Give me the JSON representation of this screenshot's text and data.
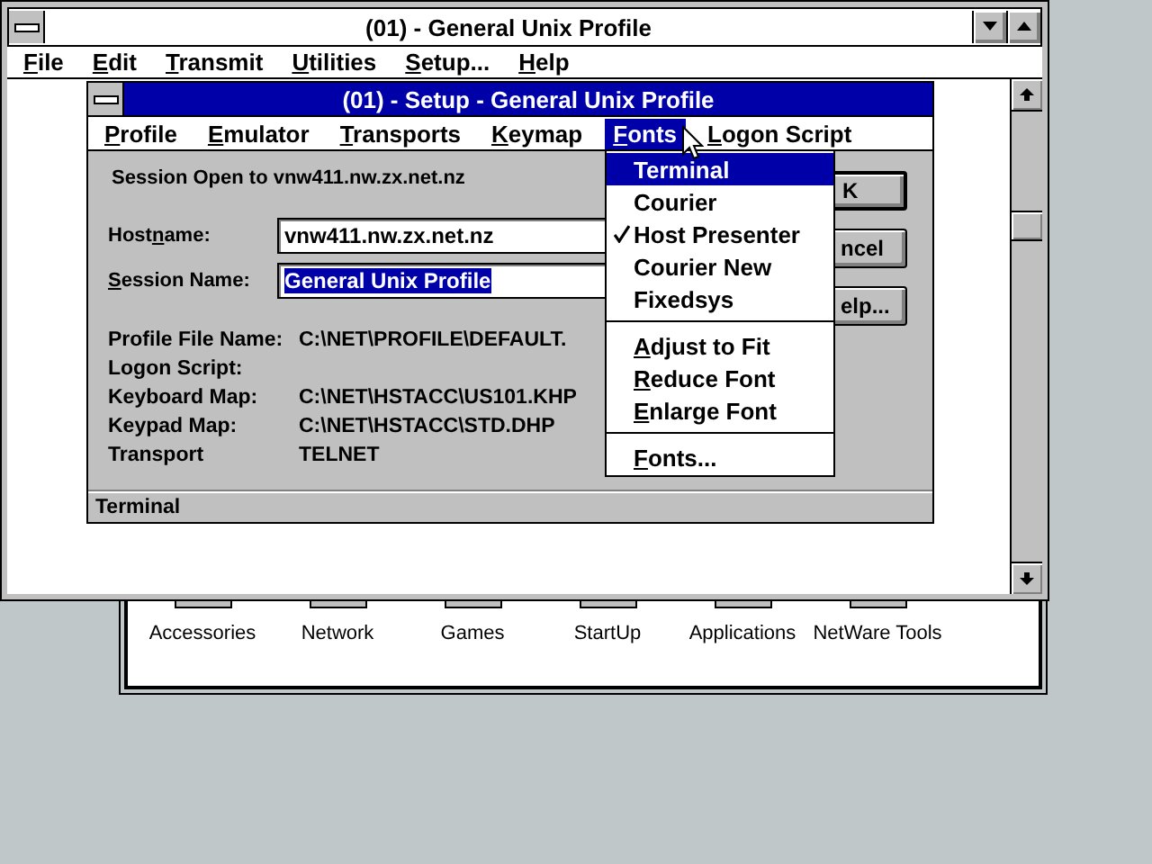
{
  "program_group_window": {
    "groups": [
      {
        "label": "Accessories"
      },
      {
        "label": "Network"
      },
      {
        "label": "Games"
      },
      {
        "label": "StartUp"
      },
      {
        "label": "Applications"
      },
      {
        "label": "NetWare Tools"
      }
    ]
  },
  "main_window": {
    "title": "(01) - General Unix Profile",
    "menu": [
      {
        "label": "File"
      },
      {
        "label": "Edit"
      },
      {
        "label": "Transmit"
      },
      {
        "label": "Utilities"
      },
      {
        "label": "Setup..."
      },
      {
        "label": "Help"
      }
    ]
  },
  "setup_dialog": {
    "title": "(01) - Setup - General Unix Profile",
    "menu": [
      {
        "label": "Profile",
        "selected": false
      },
      {
        "label": "Emulator",
        "selected": false
      },
      {
        "label": "Transports",
        "selected": false
      },
      {
        "label": "Keymap",
        "selected": false
      },
      {
        "label": "Fonts",
        "selected": true
      },
      {
        "label": "Logon Script",
        "selected": false
      }
    ],
    "session_status": "Session Open to vnw411.nw.zx.net.nz",
    "hostname": {
      "label_parts": [
        "Host",
        "n",
        "ame:"
      ],
      "value": "vnw411.nw.zx.net.nz"
    },
    "session_name": {
      "label": "Session Name:",
      "value": "General Unix Profile",
      "selected": true
    },
    "info": [
      {
        "label": "Profile File Name:",
        "value": "C:\\NET\\PROFILE\\DEFAULT."
      },
      {
        "label": "Logon Script:"
      },
      {
        "label": "Keyboard Map:",
        "value": "C:\\NET\\HSTACC\\US101.KHP"
      },
      {
        "label": "Keypad Map:",
        "value": "C:\\NET\\HSTACC\\STD.DHP"
      },
      {
        "label": "Transport",
        "value": "TELNET"
      }
    ],
    "buttons": [
      {
        "label": "K",
        "default": true
      },
      {
        "label": "ncel",
        "default": false
      },
      {
        "label": "elp...",
        "default": false
      }
    ],
    "status_bar": "Terminal"
  },
  "fonts_menu": [
    {
      "kind": "item",
      "label": "Terminal",
      "selected": true,
      "checked": false,
      "mnemonic": false
    },
    {
      "kind": "item",
      "label": "Courier",
      "selected": false,
      "checked": false,
      "mnemonic": false
    },
    {
      "kind": "item",
      "label": "Host Presenter",
      "selected": false,
      "checked": true,
      "mnemonic": false
    },
    {
      "kind": "item",
      "label": "Courier New",
      "selected": false,
      "checked": false,
      "mnemonic": false
    },
    {
      "kind": "item",
      "label": "Fixedsys",
      "selected": false,
      "checked": false,
      "mnemonic": false
    },
    {
      "kind": "separator"
    },
    {
      "kind": "item",
      "label": "Adjust to Fit",
      "selected": false,
      "checked": false,
      "mnemonic": true
    },
    {
      "kind": "item",
      "label": "Reduce Font",
      "selected": false,
      "checked": false,
      "mnemonic": true
    },
    {
      "kind": "item",
      "label": "Enlarge Font",
      "selected": false,
      "checked": false,
      "mnemonic": true
    },
    {
      "kind": "separator"
    },
    {
      "kind": "item",
      "label": "Fonts...",
      "selected": false,
      "checked": false,
      "mnemonic": true
    }
  ]
}
